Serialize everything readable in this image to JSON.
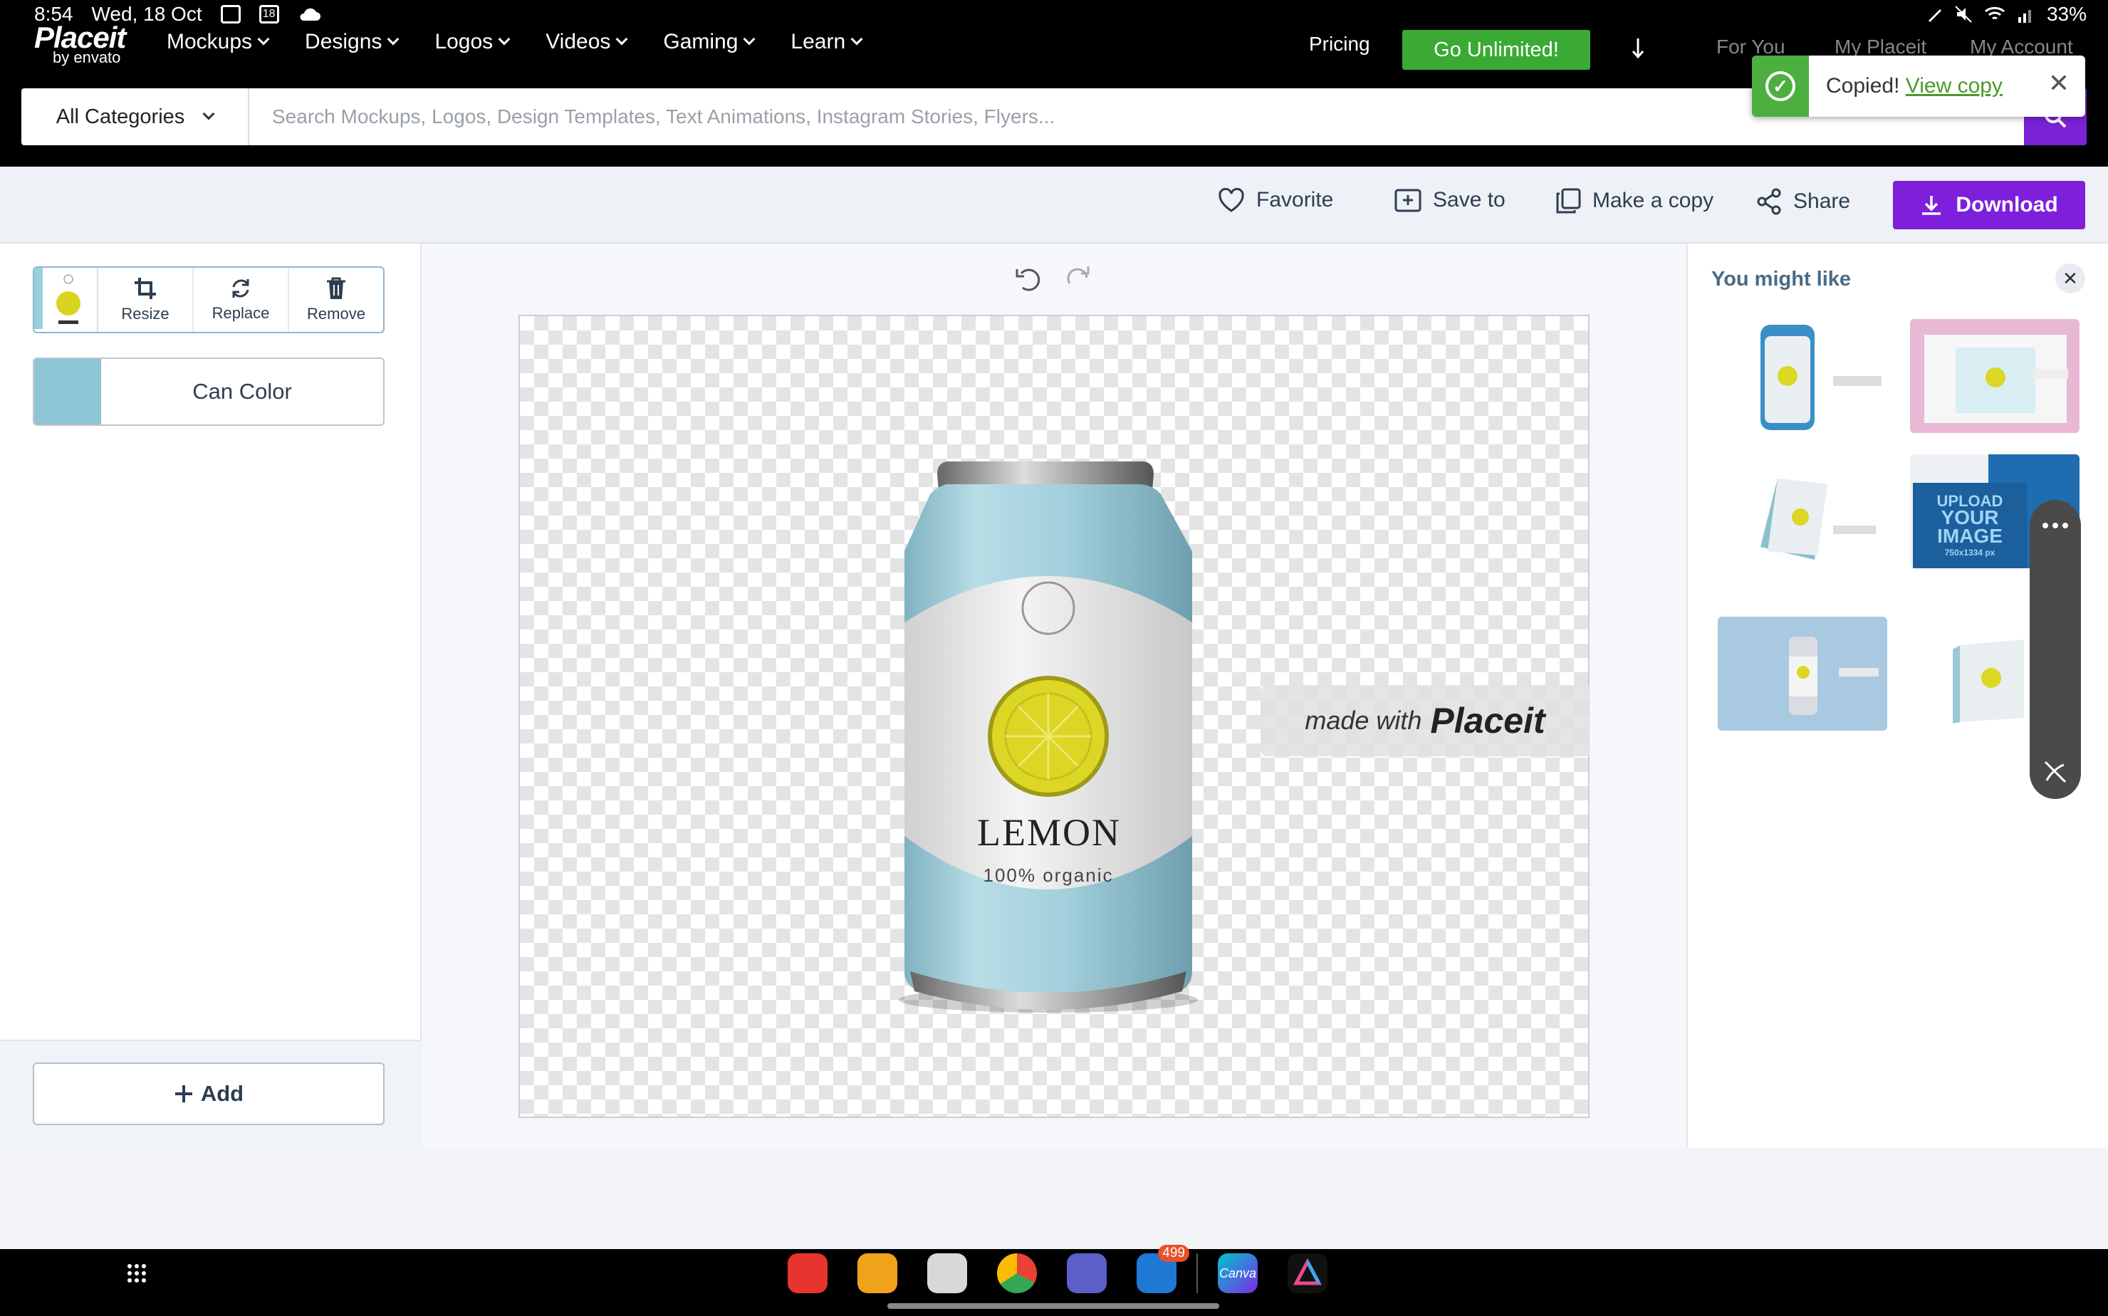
{
  "status_bar": {
    "time": "8:54",
    "date": "Wed, 18 Oct",
    "battery": "33%",
    "calendar_day": "18"
  },
  "nav": {
    "logo": "Placeit",
    "logo_sub": "by envato",
    "menu": [
      {
        "label": "Mockups"
      },
      {
        "label": "Designs"
      },
      {
        "label": "Logos"
      },
      {
        "label": "Videos"
      },
      {
        "label": "Gaming"
      },
      {
        "label": "Learn"
      }
    ],
    "pricing": "Pricing",
    "cta": "Go Unlimited!",
    "right": [
      "For You",
      "My Placeit",
      "My Account"
    ]
  },
  "toast": {
    "text": "Copied!",
    "link": "View copy"
  },
  "search": {
    "category": "All Categories",
    "placeholder": "Search Mockups, Logos, Design Templates, Text Animations, Instagram Stories, Flyers..."
  },
  "toolbar": {
    "favorite": "Favorite",
    "save_to": "Save to",
    "make_copy": "Make a copy",
    "share": "Share",
    "download": "Download"
  },
  "left_panel": {
    "layer_actions": [
      "Resize",
      "Replace",
      "Remove"
    ],
    "color_label": "Can Color",
    "swatch_color": "#8ec5d5",
    "add": "Add"
  },
  "canvas": {
    "product": {
      "brand": "LEMON",
      "tagline": "100% organic"
    },
    "watermark": {
      "prefix": "made with",
      "brand": "Placeit"
    }
  },
  "right_panel": {
    "title": "You might like",
    "thumb_text": [
      "UPLOAD",
      "YOUR",
      "IMAGE",
      "750x1334 px"
    ]
  },
  "taskbar": {
    "mail_badge": "499",
    "canva": "Canva"
  },
  "colors": {
    "accent_purple": "#7d1fdb",
    "cta_green": "#3aaa35",
    "link_green": "#4c9a2a"
  }
}
